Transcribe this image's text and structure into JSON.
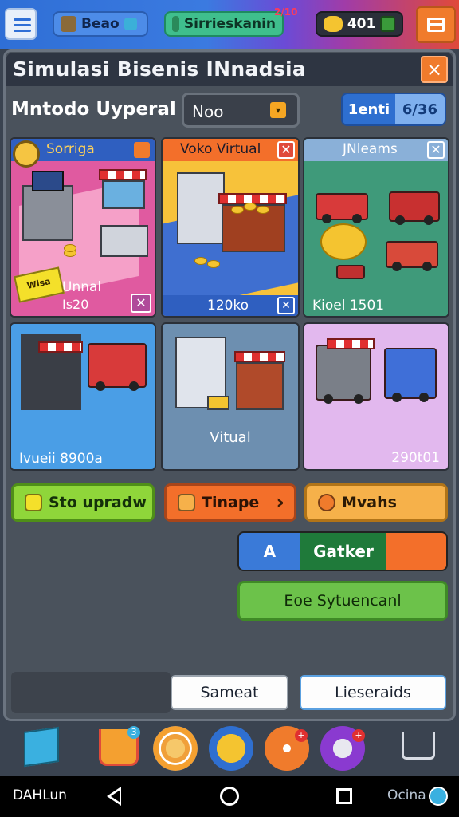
{
  "topbar": {
    "pill_1": "Beao",
    "pill_2": "Sirrieskanin",
    "score": "401",
    "corner_tag": "2/10"
  },
  "header": {
    "title": "Simulasi Bisenis INnadsia",
    "close": "×"
  },
  "controls": {
    "method_label": "Mntodo Uyperal",
    "select_value": "Noo",
    "toggle_left": "1enti",
    "toggle_right": "6/36"
  },
  "cards": [
    {
      "title": "Sorriga",
      "line1": "Unnal",
      "line2": "Is20",
      "colors": {
        "head": "#2f5fc0",
        "body": "#e05aa0"
      }
    },
    {
      "title": "Voko Virtual",
      "footer": "120ko",
      "colors": {
        "head": "#f36f2a",
        "body": "#f7c23a"
      }
    },
    {
      "title": "JNleams",
      "footer": "Kioel 1501",
      "colors": {
        "head": "#8ab0d8",
        "body": "#3f9a7a"
      }
    },
    {
      "footer": "Ivueii 8900a",
      "colors": {
        "body": "#4a9ee6"
      }
    },
    {
      "footer": "Vitual",
      "colors": {
        "body": "#6d8fb0"
      }
    },
    {
      "footer": "290t01",
      "colors": {
        "body": "#e2b8ee"
      }
    }
  ],
  "card_badge": "Wlsa",
  "actions": {
    "green": "Sto upradw",
    "orange": "Tinape",
    "amber": "Mvahs",
    "seg_a": "A",
    "seg_b": "Gatker",
    "wide": "Eoe Sytuencanl",
    "secondary": "Sameat",
    "primary": "Lieseraids"
  },
  "dock": {
    "icons": [
      "cube-icon",
      "cart-icon",
      "coin-spiral-icon",
      "coin-icon",
      "pencil-icon",
      "stamp-icon",
      "shopping-cart-icon"
    ],
    "badge_count_1": "3",
    "badge_count_2": "+"
  },
  "sysnav": {
    "left_label": "DAHLun",
    "right_label": "Ocina"
  }
}
